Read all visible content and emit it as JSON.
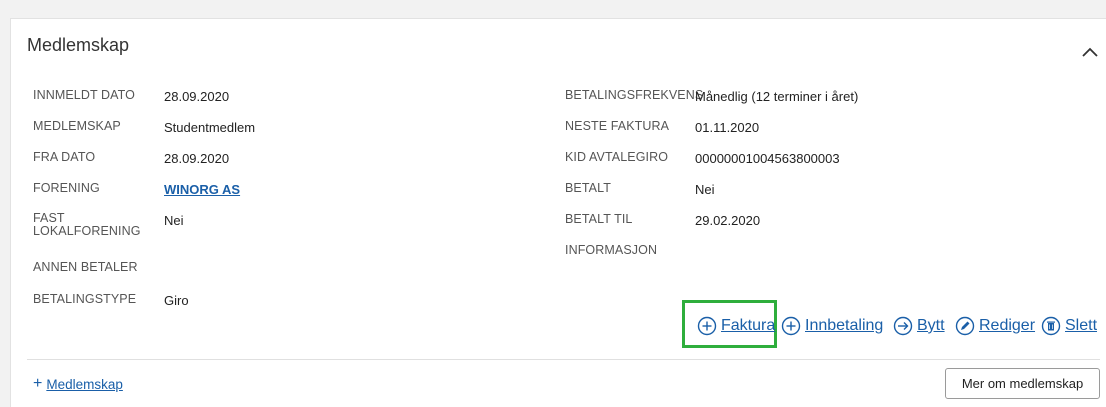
{
  "section": {
    "title": "Medlemskap"
  },
  "left_fields": [
    {
      "label": "INNMELDT DATO",
      "value": "28.09.2020"
    },
    {
      "label": "MEDLEMSKAP",
      "value": "Studentmedlem"
    },
    {
      "label": "FRA DATO",
      "value": "28.09.2020"
    },
    {
      "label": "FORENING",
      "value": "WINORG AS"
    },
    {
      "label": "FAST LOKALFORENING",
      "value": "Nei"
    },
    {
      "label": "ANNEN BETALER",
      "value": ""
    },
    {
      "label": "BETALINGSTYPE",
      "value": "Giro"
    }
  ],
  "right_fields": [
    {
      "label": "BETALINGSFREKVENS",
      "value": "Månedlig (12 terminer i året)"
    },
    {
      "label": "NESTE FAKTURA",
      "value": "01.11.2020"
    },
    {
      "label": "KID AVTALEGIRO",
      "value": "00000001004563800003"
    },
    {
      "label": "BETALT",
      "value": "Nei"
    },
    {
      "label": "BETALT TIL",
      "value": "29.02.2020"
    },
    {
      "label": "INFORMASJON",
      "value": ""
    }
  ],
  "actions": {
    "faktura": "Faktura",
    "innbetaling": "Innbetaling",
    "bytt": "Bytt",
    "rediger": "Rediger",
    "slett": "Slett"
  },
  "footer": {
    "add_plus": "+",
    "add_label": "Medlemskap",
    "more_button": "Mer om medlemskap"
  },
  "colors": {
    "link": "#1a5fa8",
    "highlight": "#2eae3c"
  }
}
